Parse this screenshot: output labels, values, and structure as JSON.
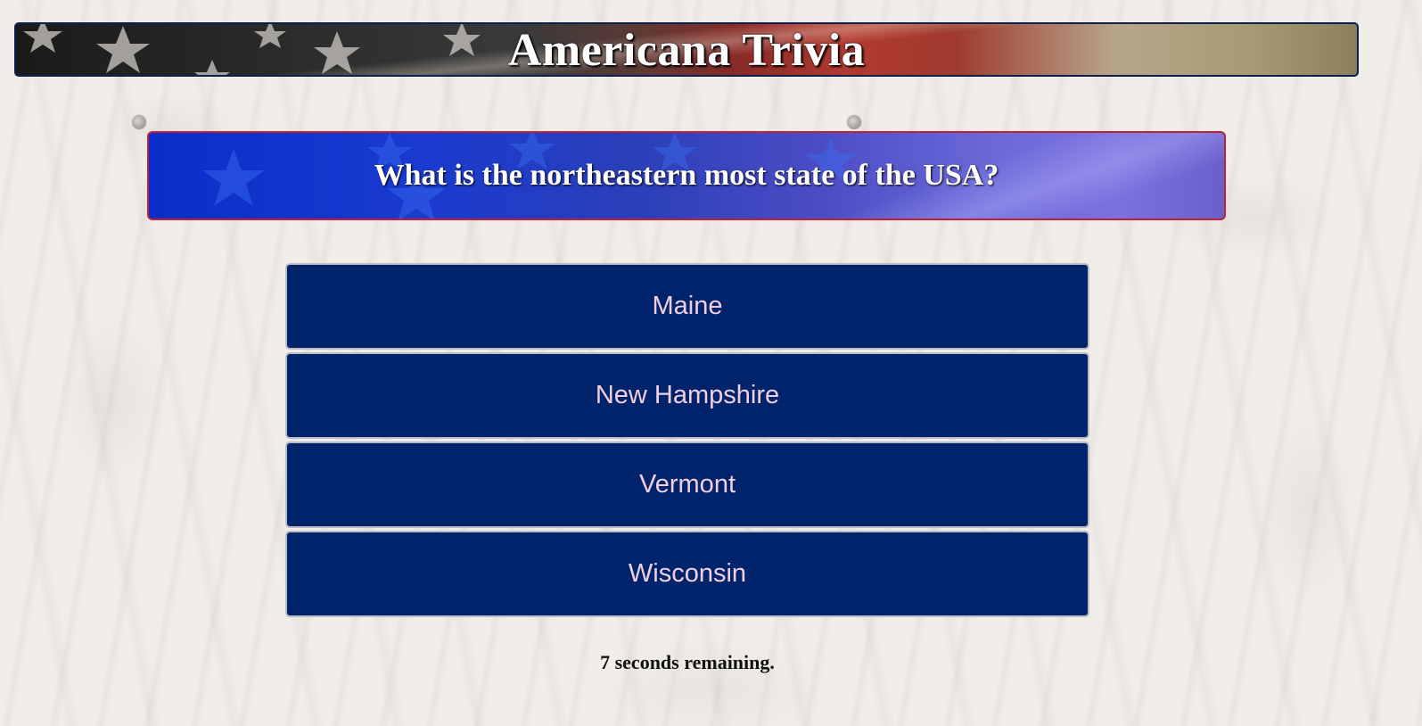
{
  "header": {
    "title": "Americana Trivia"
  },
  "question": {
    "text": "What is the northeastern most state of the USA?"
  },
  "answers": [
    {
      "label": "Maine"
    },
    {
      "label": "New Hampshire"
    },
    {
      "label": "Vermont"
    },
    {
      "label": "Wisconsin"
    }
  ],
  "timer": {
    "text": "7 seconds remaining."
  },
  "colors": {
    "answer_bg": "#00246b",
    "answer_text": "#f2cfe0",
    "question_border": "#c0203a",
    "banner_border": "#0c1f4f"
  },
  "icons": [
    "star-icon",
    "nail-icon"
  ]
}
